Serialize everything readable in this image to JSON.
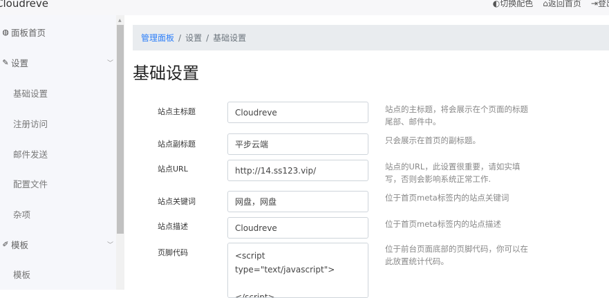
{
  "brand": "Cloudreve",
  "top_links": [
    "切换配色",
    "返回首页",
    "登出"
  ],
  "sidebar": {
    "items": [
      {
        "label": "面板首页",
        "icon": "dashboard-icon"
      },
      {
        "label": "设置",
        "icon": "wrench-icon"
      },
      {
        "label": "基础设置"
      },
      {
        "label": "注册访问"
      },
      {
        "label": "邮件发送"
      },
      {
        "label": "配置文件"
      },
      {
        "label": "杂项"
      },
      {
        "label": "模板",
        "icon": "brush-icon"
      },
      {
        "label": "模板"
      }
    ]
  },
  "breadcrumb": [
    "管理面板",
    "设置",
    "基础设置"
  ],
  "page_title": "基础设置",
  "form": [
    {
      "label": "站点主标题",
      "value": "Cloudreve",
      "help": "站点的主标题，将会展示在个页面的标题尾部、邮件中。"
    },
    {
      "label": "站点副标题",
      "value": "平步云端",
      "help": "只会展示在首页的副标题。"
    },
    {
      "label": "站点URL",
      "value": "http://14.ss123.vip/",
      "help": "站点的URL，此设置很重要，请如实填写，否则会影响系统正常工作."
    },
    {
      "label": "站点关键词",
      "value": "网盘，网盘",
      "help": "位于首页meta标签内的站点关键词"
    },
    {
      "label": "站点描述",
      "value": "Cloudreve",
      "help": "位于首页meta标签内的站点描述"
    },
    {
      "label": "页脚代码",
      "value": "<script type=\"text/javascript\">\n\n</script>",
      "help": "位于前台页面底部的页脚代码，你可以在此放置统计代码。"
    }
  ]
}
